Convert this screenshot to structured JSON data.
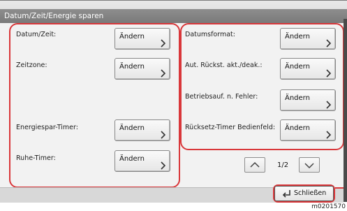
{
  "window": {
    "title": "Datum/Zeit/Energie sparen"
  },
  "left": {
    "rows": [
      {
        "label": "Datum/Zeit:",
        "button": "Ändern"
      },
      {
        "label": "Zeitzone:",
        "button": "Ändern"
      },
      {
        "label": "Energiespar-Timer:",
        "button": "Ändern"
      },
      {
        "label": "Ruhe-Timer:",
        "button": "Ändern"
      }
    ]
  },
  "right": {
    "rows": [
      {
        "label": "Datumsformat:",
        "button": "Ändern"
      },
      {
        "label": "Aut. Rückst. akt./deak.:",
        "button": "Ändern"
      },
      {
        "label": "Betriebsauf. n. Fehler:",
        "button": "Ändern"
      },
      {
        "label": "Rücksetz-Timer Bedienfeld:",
        "button": "Ändern"
      }
    ]
  },
  "pager": {
    "page": "1/2",
    "up_icon": "chevron-up-icon",
    "down_icon": "chevron-down-icon"
  },
  "footer": {
    "close_label": "Schließen",
    "close_icon": "enter-return-icon"
  },
  "footnote": "m0201570",
  "colors": {
    "highlight": "#d9373a",
    "title_bg": "#7f7f7f"
  }
}
